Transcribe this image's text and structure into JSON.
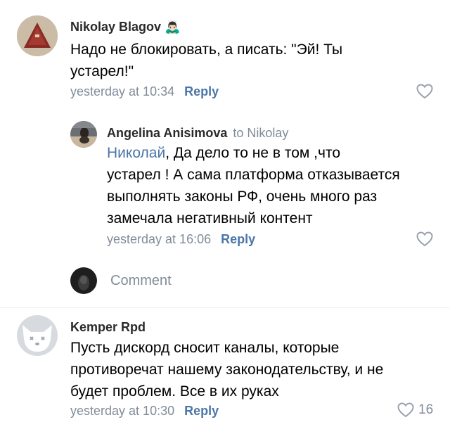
{
  "comments": [
    {
      "author": "Nikolay Blagov",
      "author_emoji": "🙇🏻‍♂️",
      "text_lines": [
        "Надо не блокировать, а писать: \"Эй! Ты",
        "устарел!\""
      ],
      "time": "yesterday at 10:34",
      "reply_label": "Reply"
    },
    {
      "author": "Angelina Anisimova",
      "reply_to": "to Nikolay",
      "mention": "Николай",
      "text_first_rest": ", Да дело то не в том ,что",
      "text_lines": [
        "устарел ! А сама платформа отказывается",
        "выполнять законы РФ, очень много раз",
        "замечала негативный контент"
      ],
      "time": "yesterday at 16:06",
      "reply_label": "Reply"
    },
    {
      "author": "Kemper Rpd",
      "text_lines": [
        "Пусть дискорд сносит каналы, которые",
        "противоречат нашему законодательству, и не",
        "будет проблем. Все в их руках"
      ],
      "time": "yesterday at 10:30",
      "reply_label": "Reply",
      "likes": "16"
    }
  ],
  "comment_input": {
    "placeholder": "Comment"
  },
  "colors": {
    "name": "#2a2a2a",
    "meta": "#818c99",
    "link": "#4a76a8"
  },
  "icons": {
    "like": "heart-outline-icon"
  }
}
